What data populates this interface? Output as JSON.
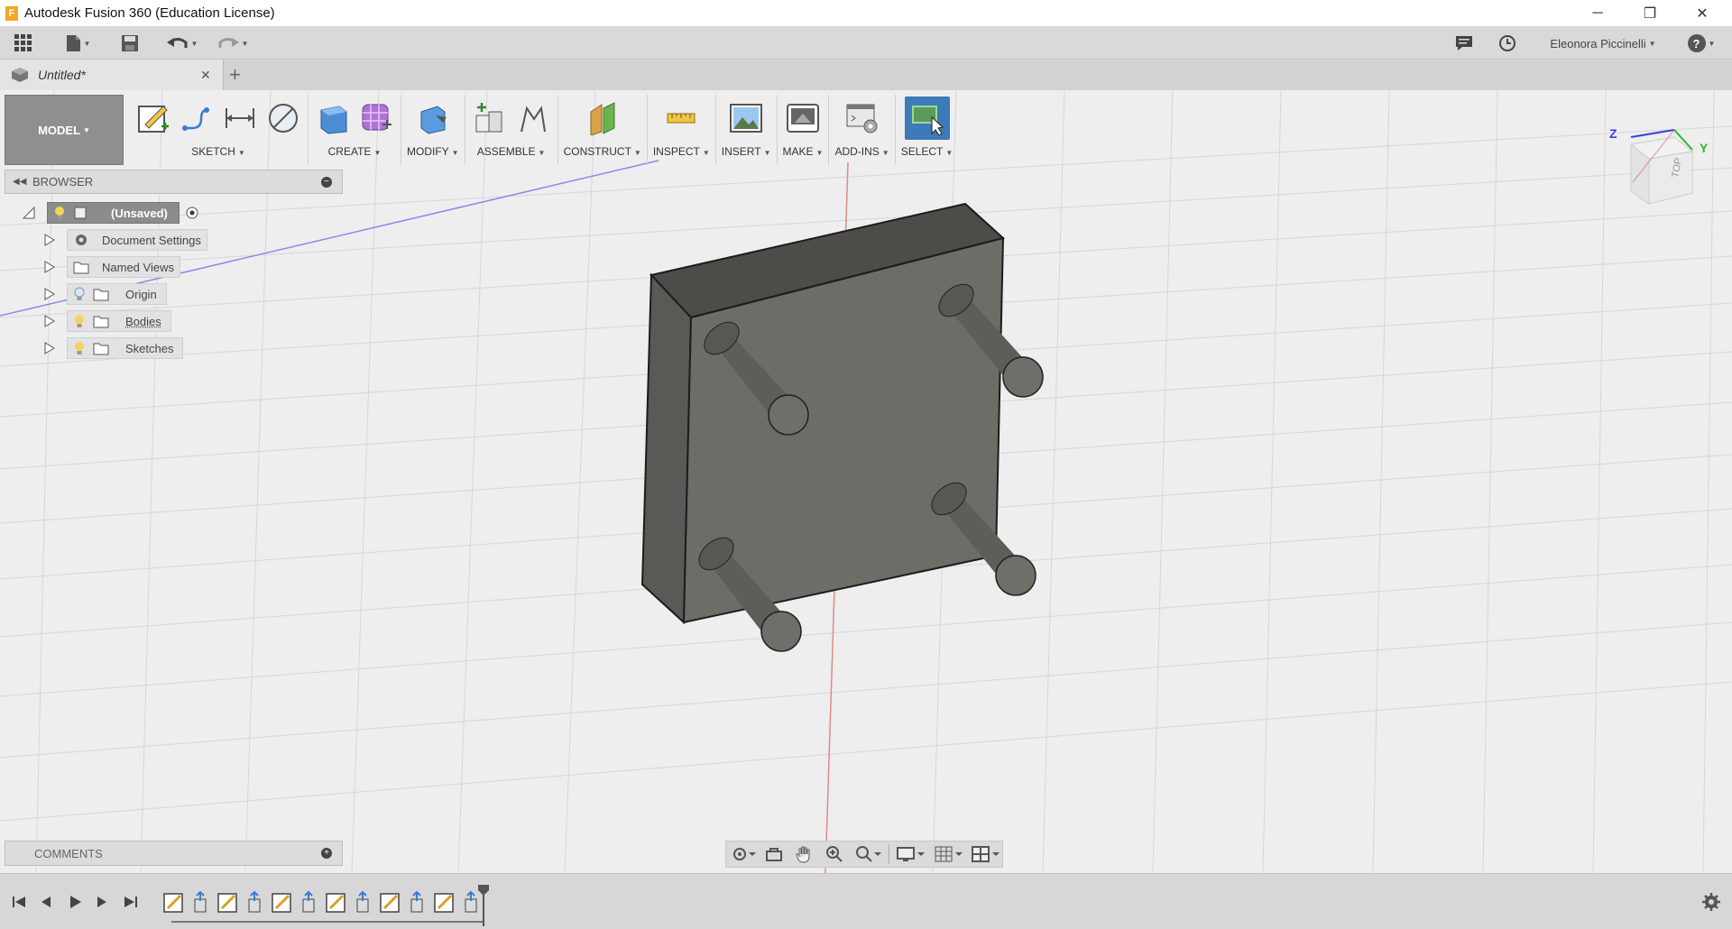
{
  "window": {
    "title": "Autodesk Fusion 360 (Education License)",
    "logo_letter": "F",
    "minimize_icon": "─",
    "restore_icon": "❐",
    "close_icon": "✕"
  },
  "quick_access": {
    "user_name": "Eleonora Piccinelli",
    "help_icon": "?"
  },
  "tabs": {
    "document_title": "Untitled*",
    "close_icon": "✕",
    "new_tab_icon": "+"
  },
  "toolbar": {
    "workspace": "MODEL",
    "groups": [
      {
        "label": "SKETCH",
        "icons": [
          "sketch-create-icon",
          "line-icon",
          "dimension-icon",
          "sketch-circle-icon"
        ]
      },
      {
        "label": "CREATE",
        "icons": [
          "extrude-icon",
          "form-icon"
        ]
      },
      {
        "label": "MODIFY",
        "icons": [
          "press-pull-icon"
        ]
      },
      {
        "label": "ASSEMBLE",
        "icons": [
          "new-component-icon",
          "joint-icon"
        ]
      },
      {
        "label": "CONSTRUCT",
        "icons": [
          "offset-plane-icon"
        ]
      },
      {
        "label": "INSPECT",
        "icons": [
          "measure-icon"
        ]
      },
      {
        "label": "INSERT",
        "icons": [
          "insert-image-icon"
        ]
      },
      {
        "label": "MAKE",
        "icons": [
          "print-3d-icon"
        ]
      },
      {
        "label": "ADD-INS",
        "icons": [
          "scripts-icon"
        ]
      },
      {
        "label": "SELECT",
        "icons": [
          "select-icon"
        ]
      }
    ]
  },
  "browser": {
    "title": "BROWSER",
    "root": "(Unsaved)",
    "nodes": [
      {
        "label": "Document Settings"
      },
      {
        "label": "Named Views"
      },
      {
        "label": "Origin"
      },
      {
        "label": "Bodies"
      },
      {
        "label": "Sketches"
      }
    ]
  },
  "comments": {
    "title": "COMMENTS"
  },
  "viewcube": {
    "face_label": "TOP",
    "axis_z": "Z",
    "axis_y": "Y"
  },
  "colors": {
    "accent_select": "#3d7ab8",
    "body_gray": "#6b6a66",
    "x_axis": "#d96b6b",
    "y_axis": "#8a8ae6"
  }
}
